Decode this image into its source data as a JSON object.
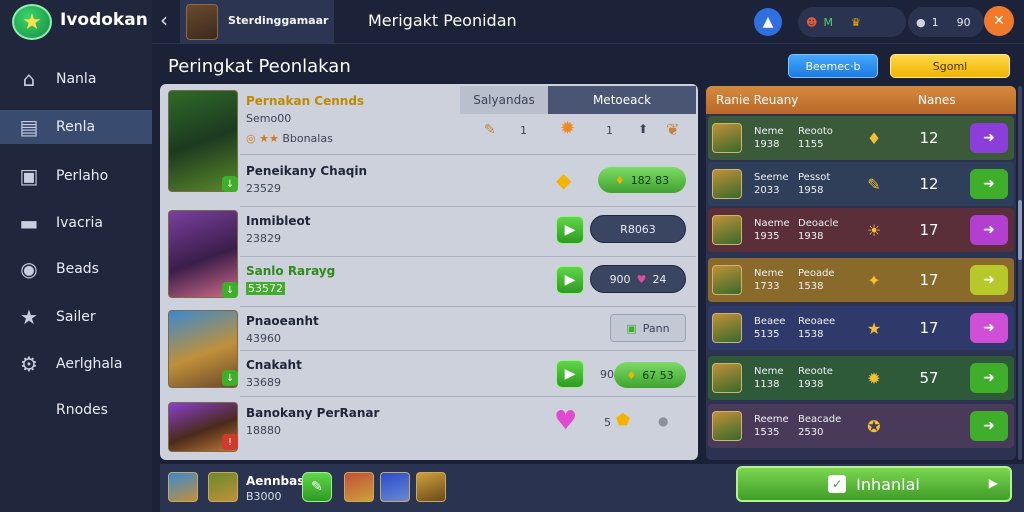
{
  "app": {
    "name": "Ivodokan"
  },
  "sidebar": {
    "items": [
      {
        "label": "Nanla",
        "icon": "home-icon"
      },
      {
        "label": "Renla",
        "icon": "list-icon"
      },
      {
        "label": "Perlaho",
        "icon": "briefcase-icon"
      },
      {
        "label": "Ivacria",
        "icon": "folder-icon"
      },
      {
        "label": "Beads",
        "icon": "badge-icon"
      },
      {
        "label": "Sailer",
        "icon": "star-icon"
      },
      {
        "label": "Aerlghala",
        "icon": "gear-icon"
      },
      {
        "label": "Rnodes",
        "icon": ""
      }
    ]
  },
  "topbar": {
    "profile_name": "Sterdinggamaar",
    "title": "Merigakt Peonidan",
    "currency1": "M",
    "currency2": "1",
    "currency3": "90"
  },
  "page": {
    "title": "Peringkat Peonlakan",
    "button_blue": "Beemec·b",
    "button_yellow": "Sgoml"
  },
  "tabs": {
    "left": "Salyandas",
    "right": "Metoeack"
  },
  "list": [
    {
      "title": "Pernakan Cennds",
      "sub": "Semo00",
      "extra": "Bbonalas",
      "n1": "1",
      "n2": "1"
    },
    {
      "title": "Peneikany Chaqin",
      "sub": "23529",
      "pill": "182 83"
    },
    {
      "title": "Inmibleot",
      "sub": "23829",
      "pill": "R8063"
    },
    {
      "title": "Sanlo Rarayg",
      "sub": "53572",
      "pill": "900",
      "pill_b": "24"
    },
    {
      "title": "Pnaoeanht",
      "sub": "43960",
      "pill": "Pann"
    },
    {
      "title": "Cnakaht",
      "sub": "33689",
      "pill": "67 53",
      "lead": "90"
    },
    {
      "title": "Banokany PerRanar",
      "sub": "18880",
      "lead": "5"
    }
  ],
  "ranking": {
    "header_left": "Ranie Reuany",
    "header_right": "Nanes",
    "rows": [
      {
        "a": "Neme",
        "b": "1938",
        "c": "Reooto",
        "d": "1155",
        "num": "12",
        "color": "#8b3fd8"
      },
      {
        "a": "Seeme",
        "b": "2033",
        "c": "Pessot",
        "d": "1958",
        "num": "12",
        "color": "#3fae2a"
      },
      {
        "a": "Naeme",
        "b": "1935",
        "c": "Deoacle",
        "d": "1938",
        "num": "17",
        "color": "#b23fd0"
      },
      {
        "a": "Neme",
        "b": "1733",
        "c": "Peoade",
        "d": "1538",
        "num": "17",
        "color": "#b6c82a"
      },
      {
        "a": "Beaee",
        "b": "5135",
        "c": "Reoaee",
        "d": "1538",
        "num": "17",
        "color": "#d04fd6"
      },
      {
        "a": "Neme",
        "b": "1138",
        "c": "Reoote",
        "d": "1938",
        "num": "57",
        "color": "#3fae2a"
      },
      {
        "a": "Reeme",
        "b": "1535",
        "c": "Beacade",
        "d": "2530",
        "num": "",
        "color": "#3fae2a"
      }
    ]
  },
  "bottom": {
    "label": "Aennbas",
    "value": "B3000",
    "main_button": "Inhanlal"
  }
}
